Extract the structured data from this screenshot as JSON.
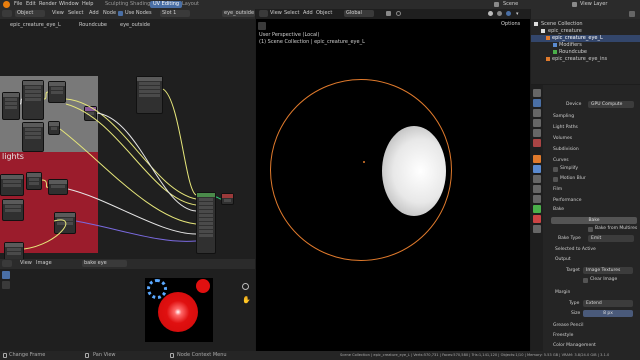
{
  "menu": {
    "items": [
      "File",
      "Edit",
      "Render",
      "Window",
      "Help"
    ],
    "workspaces": [
      "Sculpting",
      "Shading",
      "UV Editing",
      "Layout"
    ],
    "active_workspace": "UV Editing",
    "scene_label": "Scene",
    "view_layer_label": "View Layer"
  },
  "node_editor": {
    "mode": "Object",
    "menu_items": [
      "View",
      "Select",
      "Add",
      "Node"
    ],
    "use_nodes_label": "Use Nodes",
    "slot": "Slot 1",
    "material": "eye_outside",
    "breadcrumb": [
      "epic_creature_eye_L",
      "Roundcube",
      "eye_outside"
    ],
    "frame_label": "lights"
  },
  "image_editor": {
    "menu_items": [
      "View",
      "Image"
    ],
    "image_name": "bake eye"
  },
  "viewport": {
    "menu_items": [
      "View",
      "Select",
      "Add",
      "Object"
    ],
    "orientation": "Global",
    "info_line1": "User Perspective (Local)",
    "info_line2": "(1) Scene Collection | epic_creature_eye_L",
    "options_label": "Options"
  },
  "outliner": {
    "items": [
      {
        "label": "Scene Collection"
      },
      {
        "label": "epic_creature"
      },
      {
        "label": "epic_creature_eye_L"
      },
      {
        "label": "Modifiers"
      },
      {
        "label": "Roundcube"
      },
      {
        "label": "epic_creature_eye_ins"
      }
    ]
  },
  "properties": {
    "device_label": "Device",
    "device_value": "GPU Compute",
    "sections": [
      "Sampling",
      "Light Paths",
      "Volumes",
      "Subdivision",
      "Curves",
      "Simplify",
      "Motion Blur",
      "Film",
      "Performance",
      "Bake"
    ],
    "bake_button": "Bake",
    "bake_from_multires": "Bake from Multires",
    "bake_type_label": "Bake Type",
    "bake_type_value": "Emit",
    "selected_to_active": "Selected to Active",
    "output_label": "Output",
    "target_label": "Target",
    "target_value": "Image Textures",
    "clear_image": "Clear Image",
    "margin_label": "Margin",
    "type_label": "Type",
    "type_value": "Extend",
    "size_label": "Size",
    "size_value": "8 px",
    "bottom_sections": [
      "Grease Pencil",
      "Freestyle",
      "Color Management"
    ]
  },
  "status_bar": {
    "left": [
      "Change Frame",
      "Pan View",
      "Node Context Menu"
    ],
    "right": "Scene Collection | epic_creature_eye_L | Verts:570,731 | Faces:570,580 | Tris:1,141,120 | Objects:1/10 | Memory: 5.53 GB | VRAM: 3.8/24.0 GiB | 3.1.0"
  },
  "colors": {
    "accent": "#4a6fa5",
    "selection_outline": "#e07a2c",
    "frame_red": "#9b1c2c",
    "frame_gray": "#8a8a8a"
  }
}
